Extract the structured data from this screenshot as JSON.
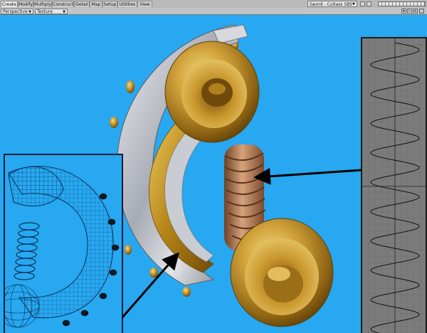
{
  "menu_tabs": [
    {
      "label": "Create",
      "active": true
    },
    {
      "label": "Modify",
      "active": false
    },
    {
      "label": "Multiply",
      "active": false
    },
    {
      "label": "Construct",
      "active": false
    },
    {
      "label": "Detail",
      "active": false
    },
    {
      "label": "Map",
      "active": false
    },
    {
      "label": "Setup",
      "active": false
    },
    {
      "label": "Utilities",
      "active": false
    },
    {
      "label": "View",
      "active": false
    }
  ],
  "scene_selector": {
    "value": "Sword - Cutlass SBS"
  },
  "viewport_header": {
    "view_mode": "Perspective",
    "render_mode": "Texture"
  },
  "colors": {
    "viewport_bg": "#27a8f0",
    "menubar_bg": "#b9b9b9",
    "gold": "#c89a2a",
    "silver": "#b8bcc4",
    "copper": "#a9764e",
    "wire": "#0b3a6a",
    "graph_bg": "#7c7c7c",
    "curve": "#111111"
  },
  "icons": [
    "minimize-icon",
    "maximize-icon",
    "move-icon",
    "rotate-icon",
    "zoom-icon",
    "maximize-view-icon",
    "arrow-icon"
  ],
  "graph_panel": {
    "cycles": 10
  }
}
